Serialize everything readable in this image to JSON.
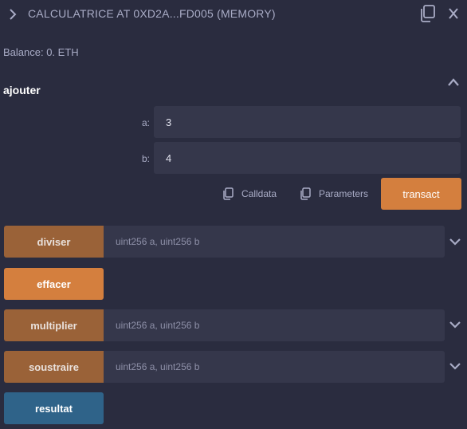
{
  "header": {
    "title": "CALCULATRICE AT 0XD2A...FD005 (MEMORY)",
    "icons": [
      "chevron-right-icon",
      "copy-icon",
      "close-icon"
    ]
  },
  "balance": "Balance: 0. ETH",
  "ajouter": {
    "name": "ajouter",
    "args": [
      {
        "label": "a:",
        "value": "3"
      },
      {
        "label": "b:",
        "value": "4"
      }
    ],
    "calldata_label": "Calldata",
    "parameters_label": "Parameters",
    "transact_label": "transact"
  },
  "functions": [
    {
      "name": "diviser",
      "placeholder": "uint256 a, uint256 b"
    },
    {
      "name": "effacer"
    },
    {
      "name": "multiplier",
      "placeholder": "uint256 a, uint256 b"
    },
    {
      "name": "soustraire",
      "placeholder": "uint256 a, uint256 b"
    },
    {
      "name": "resultat"
    }
  ],
  "colors": {
    "background": "#2a2c3f",
    "transact": "#d47f3e",
    "call": "#9a6238",
    "view": "#2f6389",
    "input": "#35374b"
  }
}
